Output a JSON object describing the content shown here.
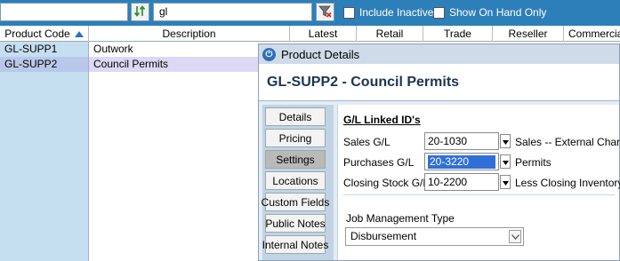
{
  "toolbar": {
    "search_value": "gl",
    "include_inactive_label": "Include Inactive",
    "show_on_hand_label": "Show On Hand Only"
  },
  "grid": {
    "columns": [
      "Product Code",
      "Description",
      "Latest",
      "Retail",
      "Trade",
      "Reseller",
      "Commercial"
    ],
    "rows": [
      {
        "code": "GL-SUPP1",
        "description": "Outwork"
      },
      {
        "code": "GL-SUPP2",
        "description": "Council Permits"
      }
    ]
  },
  "details": {
    "window_title": "Product Details",
    "heading": "GL-SUPP2 - Council Permits",
    "tabs": [
      "Details",
      "Pricing",
      "Settings",
      "Locations",
      "Custom Fields",
      "Public Notes",
      "Internal Notes"
    ],
    "section_title": "G/L Linked ID's",
    "fields": [
      {
        "label": "Sales G/L",
        "value": "20-1030",
        "desc": "Sales -- External Charges"
      },
      {
        "label": "Purchases G/L",
        "value": "20-3220",
        "desc": "Permits"
      },
      {
        "label": "Closing Stock G/L",
        "value": "10-2200",
        "desc": "Less Closing Inventory"
      }
    ],
    "job_type_label": "Job Management Type",
    "job_type_value": "Disbursement"
  }
}
